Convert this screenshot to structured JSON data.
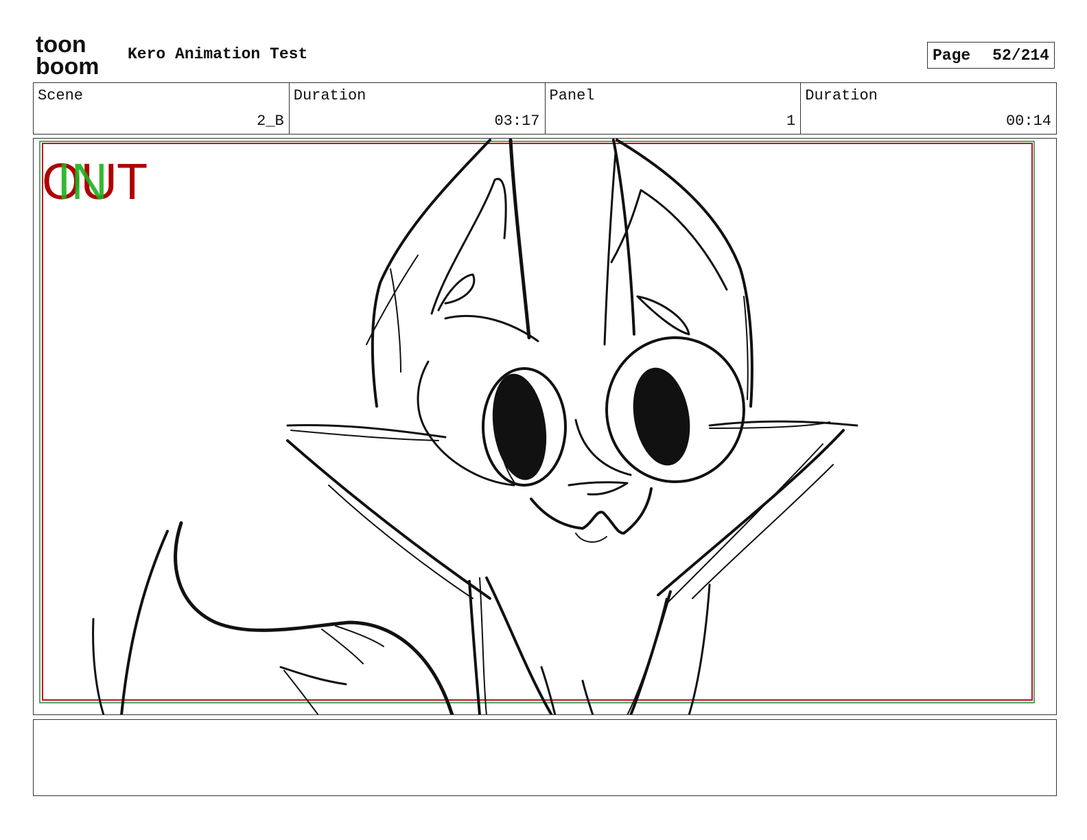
{
  "header": {
    "logo_text_top": "toon",
    "logo_text_bottom": "boom",
    "project_title": "Kero Animation Test",
    "page_label": "Page",
    "page_value": "52/214"
  },
  "info": [
    {
      "label": "Scene",
      "value": "2_B"
    },
    {
      "label": "Duration",
      "value": "03:17"
    },
    {
      "label": "Panel",
      "value": "1"
    },
    {
      "label": "Duration",
      "value": "00:14"
    }
  ],
  "panel": {
    "field_in_label": "IN",
    "field_out_label": "OUT",
    "colors": {
      "out": "#b00000",
      "in": "#1eb21e",
      "frame_red": "#c0101a",
      "frame_green": "#1a8a3a"
    }
  },
  "notes": {
    "text": ""
  }
}
